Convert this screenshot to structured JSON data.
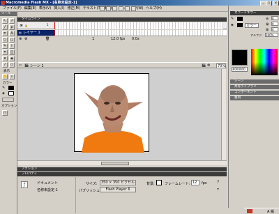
{
  "window": {
    "title": "Macromedia Flash MX - [名称未設定-1]"
  },
  "menu": [
    "ファイル(F)",
    "編集(E)",
    "表示(V)",
    "挿入(I)",
    "修正(M)",
    "テキスト(T)",
    "制御(O)",
    "ウィンドウ(W)",
    "ヘルプ(H)"
  ],
  "tools": {
    "header": "ツール",
    "view_label": "表示",
    "colors_label": "カラー",
    "options_label": "オプション"
  },
  "timeline": {
    "header": "タイムライン",
    "layer_name": "レイヤー 1",
    "frame_number": "1",
    "fps": "12.0 fps",
    "time": "0.0s"
  },
  "scene": {
    "name": "シーン 1",
    "zoom": "70%"
  },
  "properties": {
    "actions_header": "アクション",
    "header": "プロパティ",
    "doc_type": "ドキュメント",
    "doc_name": "名称未設定-1",
    "size_label": "サイズ:",
    "size_value": "350 × 350 ピクセル",
    "background_label": "背景:",
    "framerate_label": "フレームレート:",
    "framerate_value": "12",
    "fps_unit": "fps",
    "publish_label": "パブリッシュ:",
    "publish_value": "Flash Player 6"
  },
  "right_panels": {
    "color_mixer": "カラーミキサー",
    "r_label": "赤:",
    "g_label": "緑:",
    "b_label": "青:",
    "r_value": "0",
    "g_value": "0",
    "b_value": "0",
    "mode_value": "カラー",
    "alpha_label": "アルファ:",
    "alpha_value": "100%",
    "hex_value": "#000000",
    "scenes": "シーン",
    "library": "共有ライブラリ",
    "components": "コンポーネント",
    "align": "整列"
  },
  "taskbar": {
    "ime": "A 般"
  },
  "colors": {
    "accent": "#0a246a",
    "panel_dark": "#3a3a3a",
    "stage_bg": "#ffffff",
    "orange_shirt": "#f07a10"
  }
}
